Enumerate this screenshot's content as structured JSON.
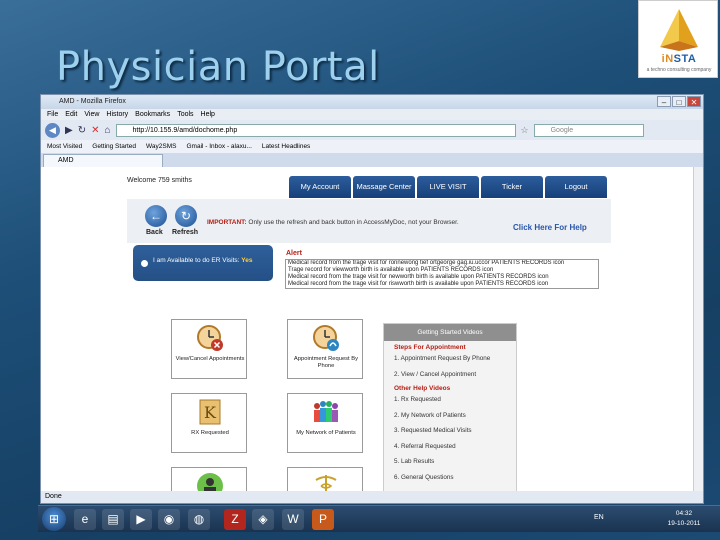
{
  "slide": {
    "title": "Physician Portal"
  },
  "logo": {
    "word_a": "iN",
    "word_b": "STA",
    "tagline": "a techno consulting company"
  },
  "browser": {
    "window_title": "AMD - Mozilla Firefox",
    "menu": [
      "File",
      "Edit",
      "View",
      "History",
      "Bookmarks",
      "Tools",
      "Help"
    ],
    "url": "http://10.155.9/amd/dochome.php",
    "search_placeholder": "Google",
    "bookmarks": [
      "Most Visited",
      "Getting Started",
      "Way2SMS",
      "Gmail - Inbox - alaxu...",
      "Latest Headlines"
    ],
    "tab_label": "AMD",
    "status": "Done"
  },
  "page": {
    "welcome": "Welcome 759 smiths",
    "nav": [
      "My Account",
      "Massage Center",
      "LIVE VISIT",
      "Ticker",
      "Logout"
    ],
    "back_label": "Back",
    "refresh_label": "Refresh",
    "important_label": "IMPORTANT:",
    "important_text": "Only use the refresh and back button in AccessMyDoc, not your Browser.",
    "help_link": "Click Here For Help",
    "er_text": "I am Available to do ER Visits:",
    "er_value": "Yes",
    "alert_label": "Alert",
    "alerts": [
      "Medical record from the trage visit for ronnewong tief ortgeorge gag.iu.uccor PATIENTS RECORDS icon",
      "Trage record for viewworth birth is available upon PATIENTS RECORDS icon",
      "Medical record from the trage visit for newworth birth is available upon PATIENTS RECORDS icon",
      "Medical record from the trage visit for riswworth birth is available upon PATIENTS RECORDS icon"
    ],
    "tiles": [
      {
        "label": "View/Cancel Appointments"
      },
      {
        "label": "Appointment Request By Phone"
      },
      {
        "label": "RX Requested"
      },
      {
        "label": "My Network of Patients"
      },
      {
        "label": ""
      },
      {
        "label": ""
      }
    ],
    "videos": {
      "header": "Getting Started Videos",
      "section1": "Steps For Appointment",
      "items1": [
        "1. Appointment Request By Phone",
        "2. View / Cancel Appointment"
      ],
      "section2": "Other Help Videos",
      "items2": [
        "1. Rx Requested",
        "2. My Network of Patients",
        "3. Requested Medical Visits",
        "4. Referral Requested",
        "5. Lab Results",
        "6. General Questions"
      ]
    }
  },
  "taskbar": {
    "lang": "EN",
    "time": "04:32",
    "date": "19-10-2011"
  }
}
